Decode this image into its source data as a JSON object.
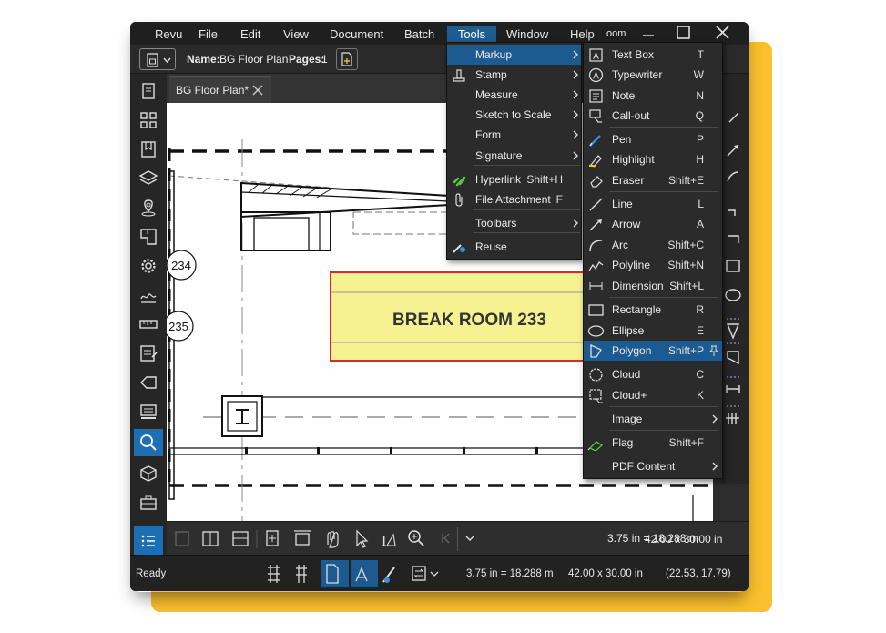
{
  "menubar": {
    "items": [
      "Revu",
      "File",
      "Edit",
      "View",
      "Document",
      "Batch",
      "Tools",
      "Window",
      "Help"
    ],
    "active": "Tools",
    "overflow_text": "oom"
  },
  "toolbar": {
    "name_label": "Name:",
    "name_value": "BG Floor Plan",
    "pages_label": "Pages:",
    "pages_value": "1"
  },
  "tab": {
    "label": "BG Floor Plan*"
  },
  "drawing": {
    "room_label": "BREAK ROOM  233",
    "marker_234": "234",
    "marker_235": "235"
  },
  "tools_menu": {
    "items": [
      {
        "label": "Markup",
        "shortcut": "",
        "submenu": true,
        "icon": "",
        "highlighted": true
      },
      {
        "label": "Stamp",
        "shortcut": "",
        "submenu": true,
        "icon": "stamp-icon"
      },
      {
        "label": "Measure",
        "shortcut": "",
        "submenu": true,
        "icon": ""
      },
      {
        "label": "Sketch to Scale",
        "shortcut": "",
        "submenu": true,
        "icon": ""
      },
      {
        "label": "Form",
        "shortcut": "",
        "submenu": true,
        "icon": ""
      },
      {
        "label": "Signature",
        "shortcut": "",
        "submenu": true,
        "icon": ""
      },
      {
        "label": "Hyperlink",
        "shortcut": "Shift+H",
        "submenu": false,
        "icon": "hyperlink-icon"
      },
      {
        "label": "File Attachment",
        "shortcut": "F",
        "submenu": false,
        "icon": "paperclip-icon"
      },
      {
        "label": "Toolbars",
        "shortcut": "",
        "submenu": true,
        "icon": ""
      },
      {
        "label": "Reuse",
        "shortcut": "",
        "submenu": false,
        "icon": "reuse-icon"
      }
    ]
  },
  "markup_menu": {
    "items": [
      {
        "label": "Text Box",
        "shortcut": "T",
        "icon": "text-box-icon"
      },
      {
        "label": "Typewriter",
        "shortcut": "W",
        "icon": "typewriter-icon"
      },
      {
        "label": "Note",
        "shortcut": "N",
        "icon": "note-icon"
      },
      {
        "label": "Call-out",
        "shortcut": "Q",
        "icon": "callout-icon"
      },
      {
        "label": "Pen",
        "shortcut": "P",
        "icon": "pen-icon"
      },
      {
        "label": "Highlight",
        "shortcut": "H",
        "icon": "highlight-icon"
      },
      {
        "label": "Eraser",
        "shortcut": "Shift+E",
        "icon": "eraser-icon"
      },
      {
        "label": "Line",
        "shortcut": "L",
        "icon": "line-icon"
      },
      {
        "label": "Arrow",
        "shortcut": "A",
        "icon": "arrow-icon"
      },
      {
        "label": "Arc",
        "shortcut": "Shift+C",
        "icon": "arc-icon"
      },
      {
        "label": "Polyline",
        "shortcut": "Shift+N",
        "icon": "polyline-icon"
      },
      {
        "label": "Dimension",
        "shortcut": "Shift+L",
        "icon": "dimension-icon"
      },
      {
        "label": "Rectangle",
        "shortcut": "R",
        "icon": "rectangle-icon"
      },
      {
        "label": "Ellipse",
        "shortcut": "E",
        "icon": "ellipse-icon"
      },
      {
        "label": "Polygon",
        "shortcut": "Shift+P",
        "icon": "polygon-icon",
        "highlighted": true
      },
      {
        "label": "Cloud",
        "shortcut": "C",
        "icon": "cloud-icon"
      },
      {
        "label": "Cloud+",
        "shortcut": "K",
        "icon": "cloud-plus-icon"
      },
      {
        "label": "Image",
        "shortcut": "",
        "icon": "",
        "submenu": true
      },
      {
        "label": "Flag",
        "shortcut": "Shift+F",
        "icon": "flag-icon"
      },
      {
        "label": "PDF Content",
        "shortcut": "",
        "icon": "",
        "submenu": true
      }
    ]
  },
  "navbar": {
    "page_size": "42.00 x 30.00 in",
    "scale": "3.75 in = 18.288 m"
  },
  "statusbar": {
    "ready": "Ready",
    "scale": "3.75 in = 18.288 m",
    "page_size": "42.00 x 30.00 in",
    "coords": "(22.53, 17.79)"
  },
  "colors": {
    "accent": "#1d5a8f",
    "room_fill": "#f6f291",
    "room_border": "#d62b2b",
    "backdrop": "#FBC02D"
  }
}
